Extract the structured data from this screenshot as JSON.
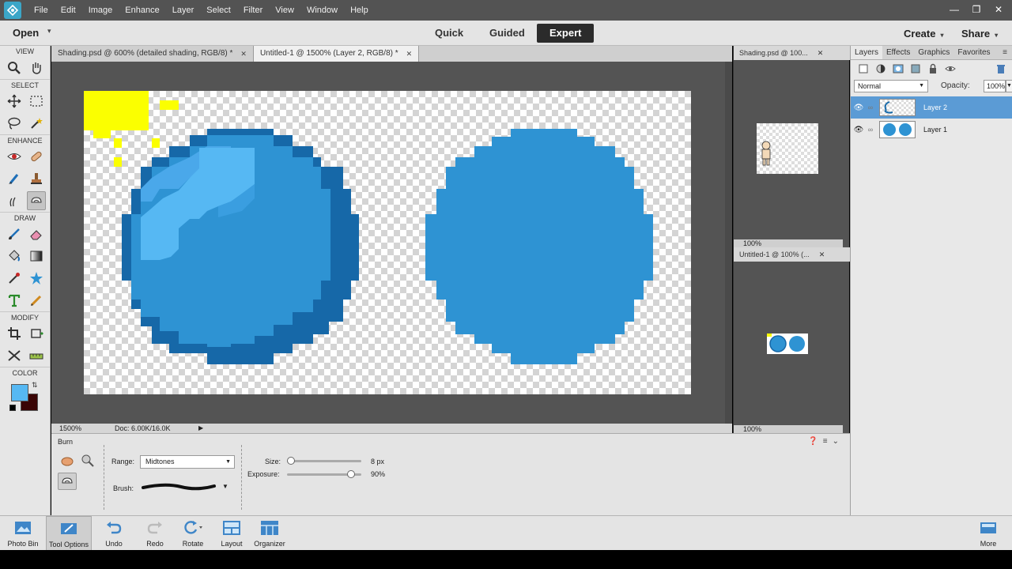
{
  "menu": {
    "items": [
      "File",
      "Edit",
      "Image",
      "Enhance",
      "Layer",
      "Select",
      "Filter",
      "View",
      "Window",
      "Help"
    ]
  },
  "modebar": {
    "open_label": "Open",
    "modes": [
      "Quick",
      "Guided",
      "Expert"
    ],
    "active_mode": "Expert",
    "create_label": "Create",
    "share_label": "Share"
  },
  "toolbar": {
    "sections": [
      "VIEW",
      "SELECT",
      "ENHANCE",
      "DRAW",
      "MODIFY",
      "COLOR"
    ],
    "foreground_color": "#56b8f3",
    "background_color": "#3a0505"
  },
  "documents": {
    "tabs": [
      {
        "label": "Shading.psd @ 600% (detailed shading, RGB/8) *",
        "active": false
      },
      {
        "label": "Untitled-1 @ 1500% (Layer 2, RGB/8) *",
        "active": true
      }
    ],
    "zoom": "1500%",
    "doc_info": "Doc: 6.00K/16.0K"
  },
  "float_windows": {
    "top_tab": "Shading.psd @ 100...",
    "top_zoom": "100%",
    "bottom_tab": "Untitled-1 @ 100% (...",
    "bottom_zoom": "100%"
  },
  "layers_panel": {
    "tabs": [
      "Layers",
      "Effects",
      "Graphics",
      "Favorites"
    ],
    "blend_mode": "Normal",
    "opacity_label": "Opacity:",
    "opacity_value": "100%",
    "layers": [
      {
        "name": "Layer 2",
        "selected": true
      },
      {
        "name": "Layer 1",
        "selected": false
      }
    ]
  },
  "tool_options": {
    "tool_name": "Burn",
    "range_label": "Range:",
    "range_value": "Midtones",
    "brush_label": "Brush:",
    "size_label": "Size:",
    "size_value": "8 px",
    "size_level": 0,
    "exposure_label": "Exposure:",
    "exposure_value": "90%",
    "exposure_level": 0.9
  },
  "taskbar": {
    "items": [
      "Photo Bin",
      "Tool Options",
      "Undo",
      "Redo",
      "Rotate",
      "Layout",
      "Organizer"
    ],
    "more_label": "More"
  },
  "colors": {
    "ball_main": "#2e93d3",
    "ball_dark": "#1668a8",
    "ball_light": "#56b8f3",
    "sun": "#fbff00",
    "accent_selected": "#5b9bd5"
  }
}
